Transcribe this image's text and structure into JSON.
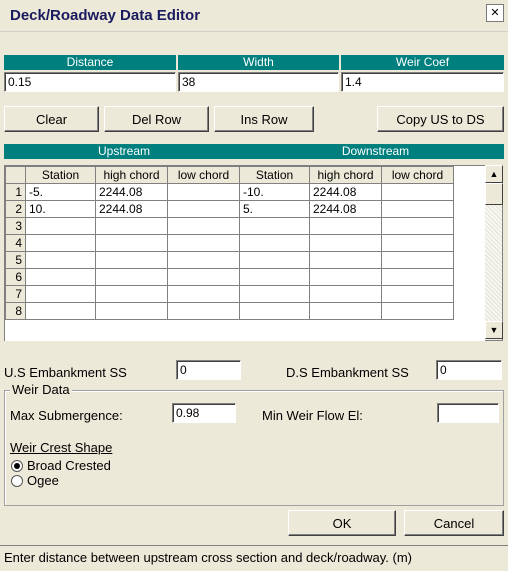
{
  "window": {
    "title": "Deck/Roadway Data Editor",
    "close_glyph": "✕"
  },
  "params": {
    "distance_header": "Distance",
    "width_header": "Width",
    "weir_coef_header": "Weir Coef",
    "distance_value": "0.15",
    "width_value": "38",
    "weir_coef_value": "1.4"
  },
  "toolbar": {
    "clear_label": "Clear",
    "del_row_label": "Del Row",
    "ins_row_label": "Ins Row",
    "copy_label": "Copy US to DS"
  },
  "grid": {
    "upstream_label": "Upstream",
    "downstream_label": "Downstream",
    "columns": [
      "Station",
      "high chord",
      "low chord",
      "Station",
      "high chord",
      "low chord"
    ],
    "rows": [
      {
        "num": "1",
        "cells": [
          "-5.",
          "2244.08",
          "",
          "-10.",
          "2244.08",
          ""
        ]
      },
      {
        "num": "2",
        "cells": [
          "10.",
          "2244.08",
          "",
          "5.",
          "2244.08",
          ""
        ]
      },
      {
        "num": "3",
        "cells": [
          "",
          "",
          "",
          "",
          "",
          ""
        ]
      },
      {
        "num": "4",
        "cells": [
          "",
          "",
          "",
          "",
          "",
          ""
        ]
      },
      {
        "num": "5",
        "cells": [
          "",
          "",
          "",
          "",
          "",
          ""
        ]
      },
      {
        "num": "6",
        "cells": [
          "",
          "",
          "",
          "",
          "",
          ""
        ]
      },
      {
        "num": "7",
        "cells": [
          "",
          "",
          "",
          "",
          "",
          ""
        ]
      },
      {
        "num": "8",
        "cells": [
          "",
          "",
          "",
          "",
          "",
          ""
        ]
      }
    ]
  },
  "embankment": {
    "us_label": "U.S Embankment SS",
    "us_value": "0",
    "ds_label": "D.S Embankment SS",
    "ds_value": "0"
  },
  "weir": {
    "group_title": "Weir Data",
    "max_sub_label": "Max  Submergence:",
    "max_sub_value": "0.98",
    "min_flow_label": "Min Weir Flow El:",
    "min_flow_value": "",
    "crest_shape_label": "Weir Crest Shape",
    "broad_crested_label": "Broad Crested",
    "ogee_label": "Ogee",
    "selected_shape": "Broad Crested"
  },
  "dialog": {
    "ok_label": "OK",
    "cancel_label": "Cancel"
  },
  "status": {
    "text": "Enter distance between upstream cross section and deck/roadway. (m)"
  },
  "icons": {
    "scroll_up": "up-arrow-icon",
    "scroll_down": "down-arrow-icon",
    "close": "close-icon"
  },
  "colors": {
    "header_teal": "#007f7f",
    "dialog_bg": "#ece9d8"
  }
}
